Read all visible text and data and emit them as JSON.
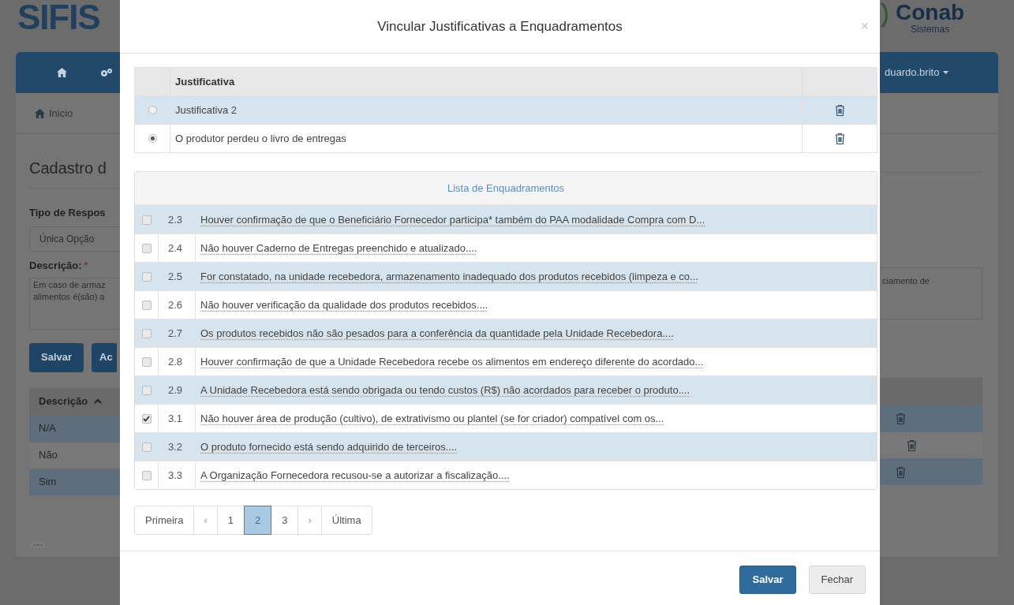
{
  "background_page": {
    "logo": "SIFIS",
    "breadcrumb": "Inicio",
    "heading": "Cadastro d",
    "type_label": "Tipo de Respos",
    "type_value": "Única Opção",
    "description_label": "Descrição:",
    "required_mark": "*",
    "description_lines": [
      "Em caso de armaz",
      "alimentos é(são) a"
    ],
    "buttons": [
      "Salvar",
      "Ac"
    ],
    "table_header": "Descrição",
    "rows": [
      "N/A",
      "Não",
      "Sim"
    ],
    "brand": "Conab",
    "brand_sub": "Sistemas",
    "user": "duardo.brito",
    "description_right": "ciamento de"
  },
  "modal": {
    "title": "Vincular Justificativas a Enquadramentos",
    "close": "×",
    "justificativas": {
      "header": "Justificativa",
      "rows": [
        {
          "text": "Justificativa 2",
          "selected": false
        },
        {
          "text": "O produtor perdeu o livro de entregas",
          "selected": true
        }
      ]
    },
    "enquadramentos": {
      "title": "Lista de Enquadramentos",
      "rows": [
        {
          "code": "2.3",
          "text": "Houver confirmação de que o Beneficiário Fornecedor participa* também do PAA modalidade Compra com D...",
          "checked": false
        },
        {
          "code": "2.4",
          "text": "Não houver Caderno de Entregas preenchido e atualizado....",
          "checked": false
        },
        {
          "code": "2.5",
          "text": "For constatado, na unidade recebedora, armazenamento inadequado dos produtos recebidos (limpeza e co...",
          "checked": false
        },
        {
          "code": "2.6",
          "text": "Não houver verificação da qualidade dos produtos recebidos....",
          "checked": false
        },
        {
          "code": "2.7",
          "text": "Os produtos recebidos não são pesados para a conferência da quantidade pela Unidade Recebedora....",
          "checked": false
        },
        {
          "code": "2.8",
          "text": "Houver confirmação de que a Unidade Recebedora recebe os alimentos em endereço diferente do acordado...",
          "checked": false
        },
        {
          "code": "2.9",
          "text": "A Unidade Recebedora está sendo obrigada ou tendo custos (R$) não acordados para receber o produto....",
          "checked": false
        },
        {
          "code": "3.1",
          "text": "Não houver área de produção (cultivo), de extrativismo ou plantel (se for criador) compatível com os...",
          "checked": true
        },
        {
          "code": "3.2",
          "text": "O produto fornecido está sendo adquirido de terceiros....",
          "checked": false
        },
        {
          "code": "3.3",
          "text": "A Organização Fornecedora recusou-se a autorizar a fiscalização....",
          "checked": false
        }
      ]
    },
    "pagination": [
      {
        "label": "Primeira",
        "kind": "link",
        "selected": false
      },
      {
        "label": "‹",
        "kind": "arrow",
        "selected": false
      },
      {
        "label": "1",
        "kind": "link",
        "selected": false
      },
      {
        "label": "2",
        "kind": "link",
        "selected": true
      },
      {
        "label": "3",
        "kind": "link",
        "selected": false
      },
      {
        "label": "›",
        "kind": "arrow",
        "selected": false
      },
      {
        "label": "Última",
        "kind": "link",
        "selected": false
      }
    ],
    "buttons": [
      {
        "label": "Salvar",
        "kind": "primary"
      },
      {
        "label": "Fechar",
        "kind": "default"
      }
    ]
  }
}
